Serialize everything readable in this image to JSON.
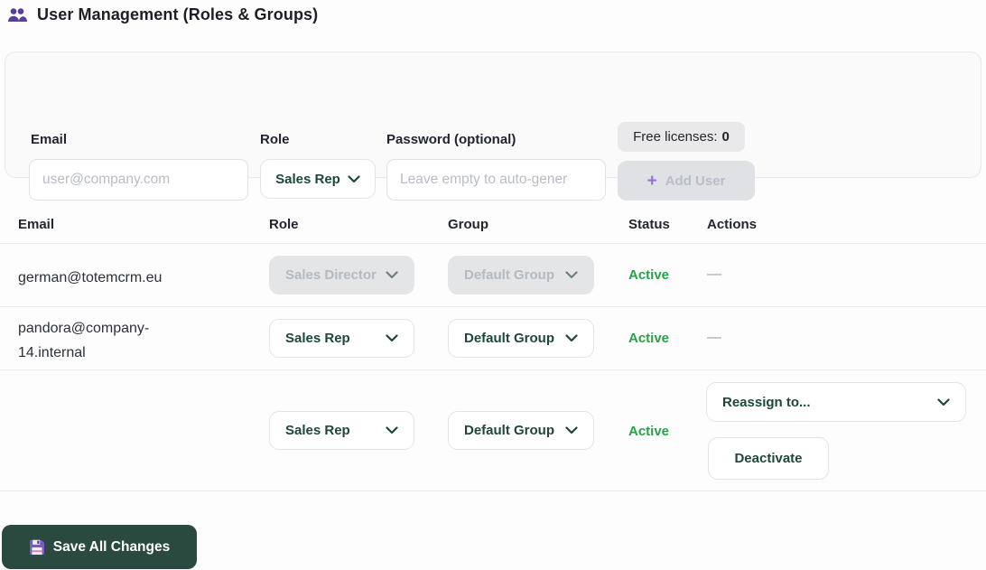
{
  "header": {
    "title": "User Management (Roles & Groups)"
  },
  "add_user_form": {
    "email_label": "Email",
    "email_placeholder": "user@company.com",
    "email_value": "",
    "role_label": "Role",
    "role_value": "Sales Rep",
    "password_label": "Password (optional)",
    "password_placeholder": "Leave empty to auto-gener",
    "password_value": "",
    "free_licenses_label": "Free licenses:",
    "free_licenses_value": "0",
    "add_user_label": "Add User",
    "plus_glyph": "+"
  },
  "table": {
    "columns": [
      "Email",
      "Role",
      "Group",
      "Status",
      "Actions"
    ],
    "rows": [
      {
        "email": "german@totemcrm.eu",
        "role": "Sales Director",
        "group": "Default Group",
        "status": "Active",
        "actions": "—"
      },
      {
        "email": "pandora@company-14.internal",
        "role": "Sales Rep",
        "group": "Default Group",
        "status": "Active",
        "actions": "—"
      },
      {
        "email": "",
        "role": "Sales Rep",
        "group": "Default Group",
        "status": "Active",
        "reassign_label": "Reassign to...",
        "deactivate_label": "Deactivate"
      }
    ]
  },
  "footer": {
    "save_button_label": "Save All Changes"
  },
  "colors": {
    "accent_purple": "#5b3d9e",
    "teal_text": "#1d473d",
    "active_green": "#26a248",
    "save_button_bg": "#2a4a40",
    "disabled_bg": "#e3e5e7"
  }
}
